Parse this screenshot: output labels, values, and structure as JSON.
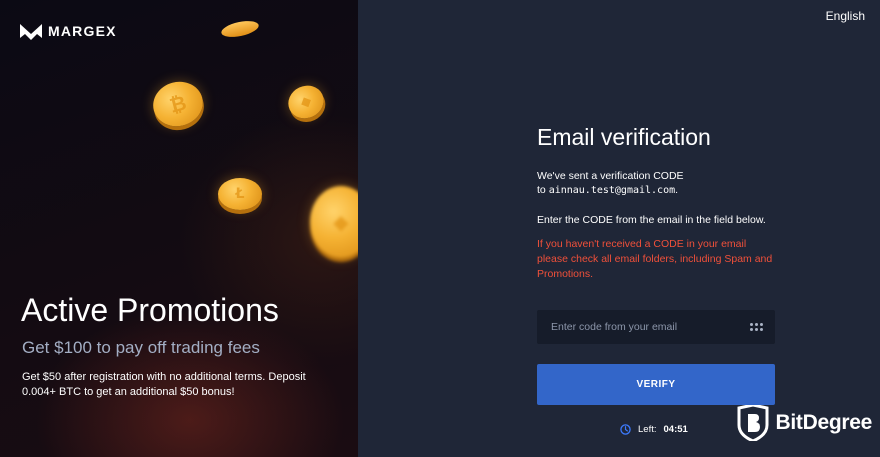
{
  "brand": {
    "name": "MARGEX"
  },
  "promo": {
    "title": "Active Promotions",
    "subtitle": "Get $100 to pay off trading fees",
    "description": "Get $50 after registration with no additional terms. Deposit 0.004+ BTC to get an additional $50 bonus!"
  },
  "header": {
    "language": "English"
  },
  "verification": {
    "title": "Email verification",
    "sent_line": "We've sent a verification CODE",
    "to_prefix": "to ",
    "email": "ainnau.test@gmail.com",
    "email_suffix": ".",
    "instruction": "Enter the CODE from the email in the field below.",
    "warning": "If you haven't received a CODE in your email please check all email folders, including Spam and Promotions.",
    "code_placeholder": "Enter code from your email",
    "verify_label": "VERIFY",
    "timer_label": "Left:",
    "timer_value": "04:51"
  },
  "watermark": {
    "text": "BitDegree"
  },
  "colors": {
    "accent": "#3366c9",
    "warning": "#f0503a",
    "panel_bg": "#1f2637",
    "input_bg": "#161c2a",
    "coin": "#f5b233"
  },
  "icons": [
    "margex-logo-icon",
    "bitcoin-icon",
    "litecoin-icon",
    "keypad-dots-icon",
    "clock-icon",
    "bitdegree-shield-icon"
  ]
}
